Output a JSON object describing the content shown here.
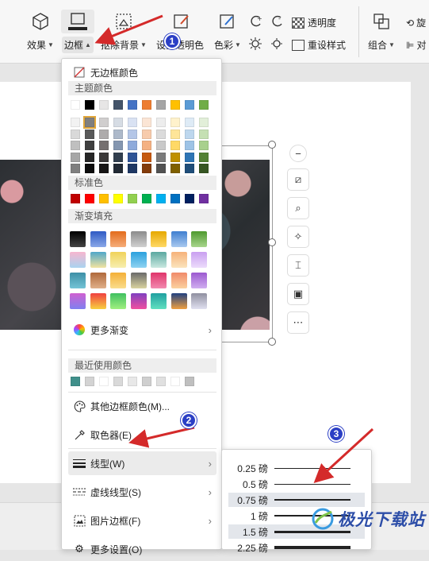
{
  "ribbon": {
    "effects_label": "效果",
    "border_label": "边框",
    "remove_bg_label": "抠除背景",
    "transparent_label": "设置透明色",
    "color_label": "色彩",
    "transparency_label": "透明度",
    "reset_style_label": "重设样式",
    "group_label": "组合",
    "rotate_label": "旋",
    "align_label": "对"
  },
  "border_menu": {
    "no_border_label": "无边框颜色",
    "theme_colors_header": "主题颜色",
    "theme_top_row": [
      "#ffffff",
      "#000000",
      "#e7e6e6",
      "#44546a",
      "#4472c4",
      "#ed7d31",
      "#a5a5a5",
      "#ffc000",
      "#5b9bd5",
      "#70ad47"
    ],
    "theme_shades": [
      [
        "#f2f2f2",
        "#7f7f7f",
        "#d0cece",
        "#d6dce4",
        "#d9e2f3",
        "#fbe5d5",
        "#ededed",
        "#fff2cc",
        "#deebf6",
        "#e2efd9"
      ],
      [
        "#d9d9d9",
        "#595959",
        "#aeabab",
        "#adb9ca",
        "#b4c6e7",
        "#f7cbac",
        "#dbdbdb",
        "#fee599",
        "#bdd7ee",
        "#c5e0b3"
      ],
      [
        "#bfbfbf",
        "#3f3f3f",
        "#757070",
        "#8496b0",
        "#8eaadb",
        "#f4b183",
        "#c9c9c9",
        "#ffd966",
        "#9dc3e6",
        "#a8d08d"
      ],
      [
        "#a6a6a6",
        "#262626",
        "#3a3838",
        "#323f4f",
        "#2f5496",
        "#c55a11",
        "#7b7b7b",
        "#bf9000",
        "#2e75b5",
        "#538135"
      ],
      [
        "#7f7f7f",
        "#0d0d0d",
        "#171616",
        "#222a35",
        "#1f3864",
        "#833c0b",
        "#525252",
        "#7f6000",
        "#1f4e79",
        "#375623"
      ]
    ],
    "standard_header": "标准色",
    "standard_colors": [
      "#c00000",
      "#ff0000",
      "#ffc000",
      "#ffff00",
      "#92d050",
      "#00b050",
      "#00b0f0",
      "#0070c0",
      "#002060",
      "#7030a0"
    ],
    "gradient_header": "渐变填充",
    "gradients": [
      [
        "#000000|#444444",
        "#2f5bc4|#8aa8e8",
        "#e36c1c|#f5ad7a",
        "#8c8c8c|#d0d0d0",
        "#e6a800|#ffd966",
        "#3f7fd0|#a9c9f0",
        "#4e9a2e|#a8d68d"
      ],
      [
        "#f7b6cf|#a9d3f0",
        "#4fa8c9|#f2e4a0",
        "#f0d25a|#f7efb0",
        "#2aa1dd|#8fd3f2",
        "#5aa8a0|#c9e8e0",
        "#f6b27a|#fbe4bd",
        "#c9a0f0|#ecdcfb"
      ],
      [
        "#3d8fa6|#74c4d6",
        "#b0693a|#e0b08a",
        "#f4b038|#fadd8c",
        "#6a6a6a|#d9d3a0",
        "#e0356b|#f28ab0",
        "#f08a6a|#fbd2a0",
        "#9c5ad0|#d0aef0"
      ],
      [
        "#d060d0|#8080f0",
        "#f04040|#f8d040",
        "#40c060|#a0f080",
        "#8040c0|#f050a0",
        "#20a0a0|#60e0c0",
        "#204080|#f0a040",
        "#9090a0|#e0e0f0"
      ]
    ],
    "more_gradients_label": "更多渐变",
    "recent_header": "最近使用颜色",
    "recent_colors": [
      "#3f8f8a",
      "#d3d3d3",
      "#ffffff",
      "#d9d9d9",
      "#e8e8e8",
      "#cfcfcf",
      "#e0e0e0",
      "#ffffff",
      "#bfbfbf"
    ],
    "other_colors_label": "其他边框颜色(M)...",
    "eyedropper_label": "取色器(E)",
    "line_type_label": "线型(W)",
    "dash_type_label": "虚线线型(S)",
    "picture_border_label": "图片边框(F)",
    "more_settings_label": "更多设置(O)"
  },
  "line_weights": [
    {
      "label": "0.25 磅",
      "weight": 1
    },
    {
      "label": "0.5 磅",
      "weight": 1
    },
    {
      "label": "0.75 磅",
      "weight": 2
    },
    {
      "label": "1 磅",
      "weight": 2
    },
    {
      "label": "1.5 磅",
      "weight": 3
    },
    {
      "label": "2.25 磅",
      "weight": 4
    }
  ],
  "badges": {
    "one": "1",
    "two": "2",
    "three": "3"
  },
  "watermark": {
    "text": "极光下载站"
  },
  "colors": {
    "accent_badge": "#2b3fc5",
    "arrow": "#d42a2a"
  }
}
